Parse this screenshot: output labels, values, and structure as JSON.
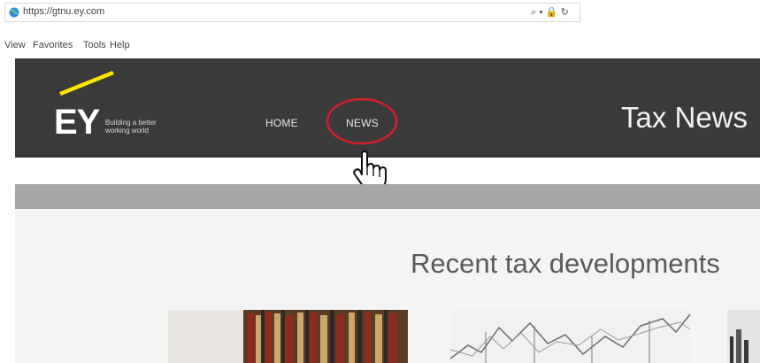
{
  "browser": {
    "url": "https://gtnu.ey.com",
    "address_tools": "⌕ ▾ 🔒 ↻",
    "menu": [
      "View",
      "Favorites",
      "Tools",
      "Help"
    ]
  },
  "site": {
    "logo": "EY",
    "tagline": "Building a better working world",
    "nav": {
      "home": "HOME",
      "news": "NEWS"
    },
    "title": "Tax News",
    "accent_color": "#ffe600",
    "highlight_color": "#d0202a"
  },
  "content": {
    "heading": "Recent tax developments"
  }
}
